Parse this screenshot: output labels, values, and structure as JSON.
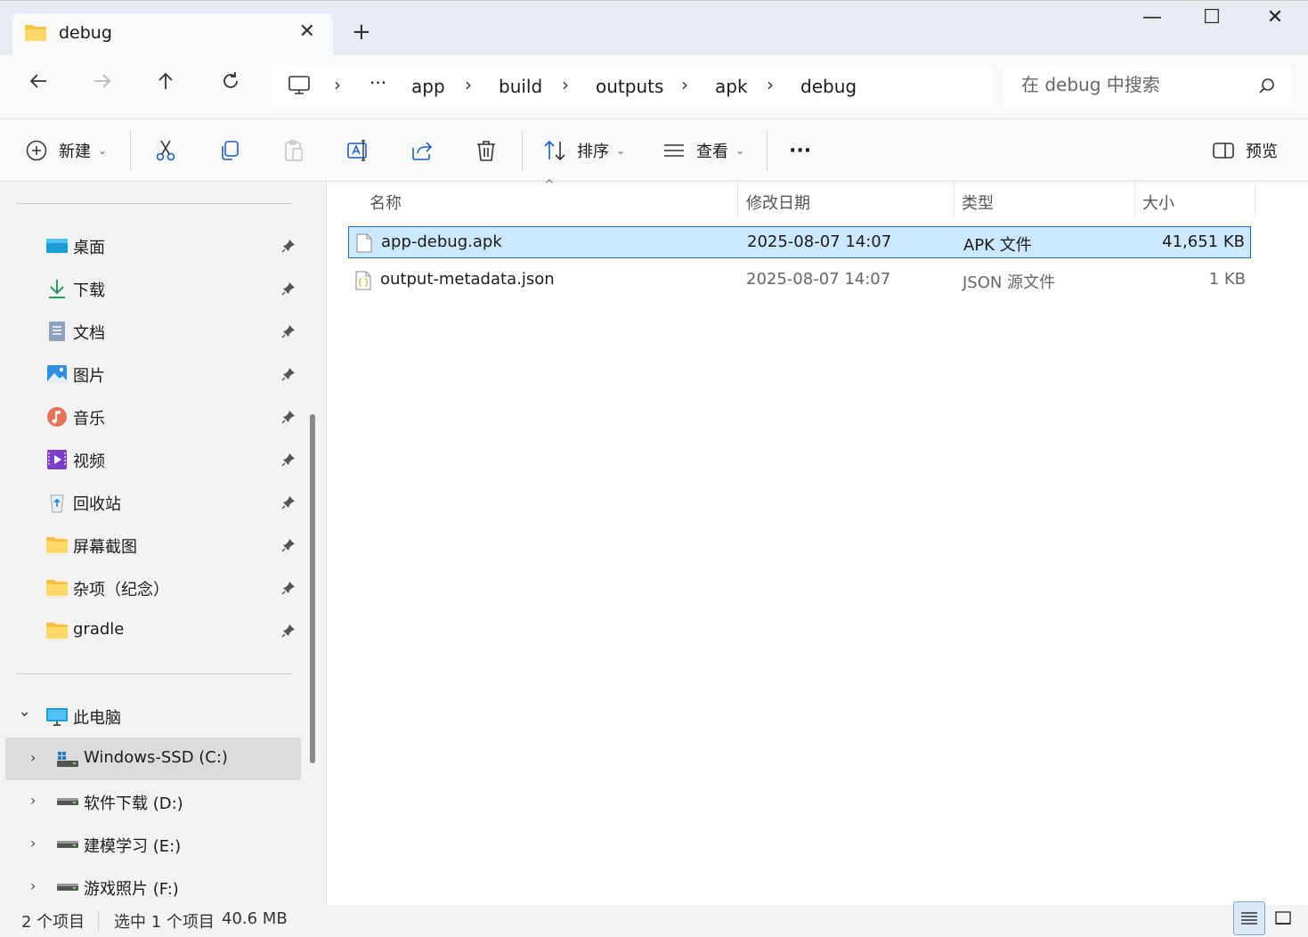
{
  "tab": {
    "title": "debug",
    "close": "✕",
    "new": "+"
  },
  "window_controls": {
    "minimize": "—",
    "maximize": "☐",
    "close": "✕"
  },
  "breadcrumb": [
    "···",
    "app",
    "build",
    "outputs",
    "apk",
    "debug"
  ],
  "breadcrumb_sep": "›",
  "search": {
    "placeholder": "在 debug 中搜索"
  },
  "toolbar": {
    "new_label": "新建",
    "sort_label": "排序",
    "view_label": "查看",
    "more": "···",
    "preview_label": "预览",
    "caret": "⌄"
  },
  "sidebar": {
    "quick_access": [
      {
        "label": "桌面",
        "icon": "desktop-icon"
      },
      {
        "label": "下载",
        "icon": "download-icon"
      },
      {
        "label": "文档",
        "icon": "documents-icon"
      },
      {
        "label": "图片",
        "icon": "pictures-icon"
      },
      {
        "label": "音乐",
        "icon": "music-icon"
      },
      {
        "label": "视频",
        "icon": "videos-icon"
      },
      {
        "label": "回收站",
        "icon": "recycle-bin-icon"
      },
      {
        "label": "屏幕截图",
        "icon": "folder-icon"
      },
      {
        "label": "杂项（纪念）",
        "icon": "folder-icon"
      },
      {
        "label": "gradle",
        "icon": "folder-icon"
      }
    ],
    "this_pc": {
      "label": "此电脑",
      "chevron": "⌄"
    },
    "drives": [
      {
        "label": "Windows-SSD (C:)",
        "icon": "windows-drive-icon",
        "selected": true
      },
      {
        "label": "软件下载 (D:)",
        "icon": "drive-icon"
      },
      {
        "label": "建模学习 (E:)",
        "icon": "drive-icon"
      },
      {
        "label": "游戏照片 (F:)",
        "icon": "drive-icon"
      }
    ],
    "drive_chevron": "›"
  },
  "file_list": {
    "columns": [
      "名称",
      "修改日期",
      "类型",
      "大小"
    ],
    "sort_indicator": "^",
    "rows": [
      {
        "name": "app-debug.apk",
        "date": "2025-08-07 14:07",
        "type": "APK 文件",
        "size": "41,651 KB",
        "selected": true
      },
      {
        "name": "output-metadata.json",
        "date": "2025-08-07 14:07",
        "type": "JSON 源文件",
        "size": "1 KB",
        "selected": false
      }
    ]
  },
  "status": {
    "count": "2 个项目",
    "selected": "选中 1 个项目",
    "size": "40.6 MB"
  }
}
